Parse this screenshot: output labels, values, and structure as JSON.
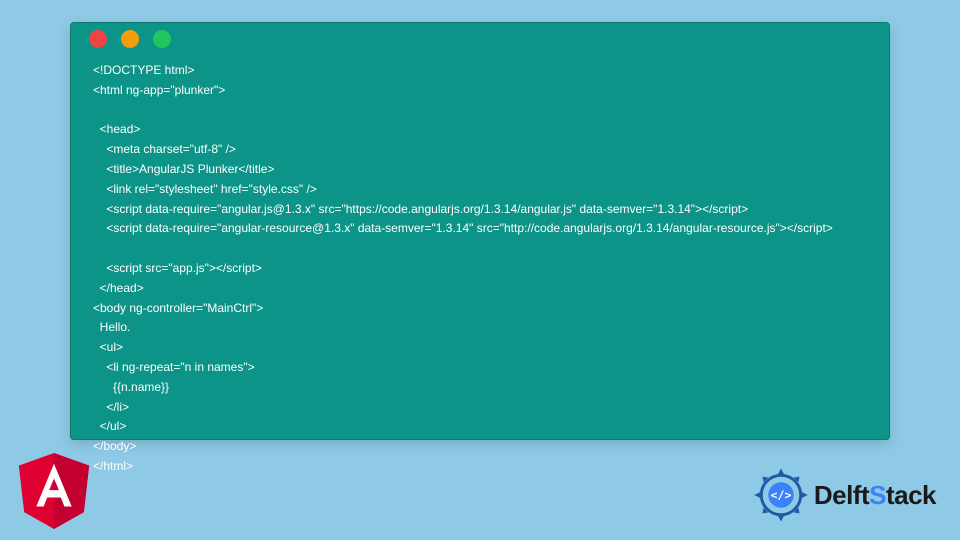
{
  "window": {
    "dots": [
      "red",
      "yellow",
      "green"
    ]
  },
  "code": {
    "l01": "<!DOCTYPE html>",
    "l02": "<html ng-app=\"plunker\">",
    "l03": "",
    "l04": "  <head>",
    "l05": "    <meta charset=\"utf-8\" />",
    "l06": "    <title>AngularJS Plunker</title>",
    "l07": "    <link rel=\"stylesheet\" href=\"style.css\" />",
    "l08": "    <script data-require=\"angular.js@1.3.x\" src=\"https://code.angularjs.org/1.3.14/angular.js\" data-semver=\"1.3.14\"></script>",
    "l09": "    <script data-require=\"angular-resource@1.3.x\" data-semver=\"1.3.14\" src=\"http://code.angularjs.org/1.3.14/angular-resource.js\"></script>",
    "l10": "",
    "l11": "    <script src=\"app.js\"></script>",
    "l12": "  </head>",
    "l13": "<body ng-controller=\"MainCtrl\">",
    "l14": "  Hello.",
    "l15": "  <ul>",
    "l16": "    <li ng-repeat=\"n in names\">",
    "l17": "      {{n.name}}",
    "l18": "    </li>",
    "l19": "  </ul>",
    "l20": "</body>",
    "l21": "</html>"
  },
  "logos": {
    "angular_letter": "A",
    "delft_brand": "DelftStack"
  }
}
